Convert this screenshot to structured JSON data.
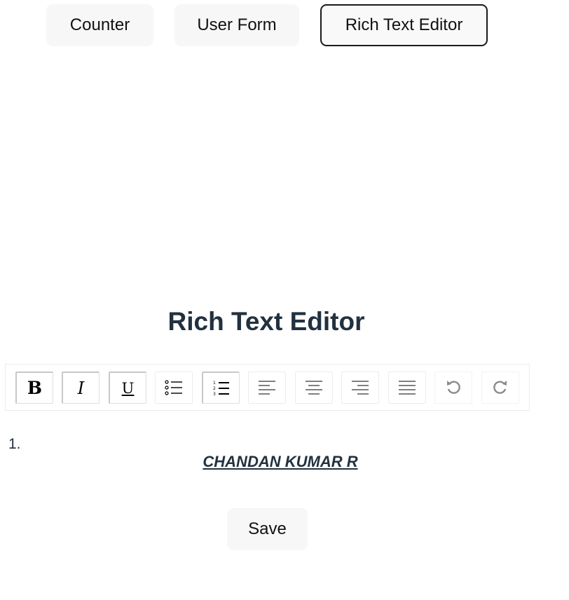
{
  "tabs": [
    {
      "label": "Counter",
      "active": false
    },
    {
      "label": "User Form",
      "active": false
    },
    {
      "label": "Rich Text Editor",
      "active": true
    }
  ],
  "title": "Rich Text Editor",
  "toolbar": {
    "buttons": [
      {
        "name": "bold",
        "icon": "bold-icon",
        "glyph": "B",
        "pressed": true
      },
      {
        "name": "italic",
        "icon": "italic-icon",
        "glyph": "I",
        "pressed": true
      },
      {
        "name": "underline",
        "icon": "underline-icon",
        "glyph": "U",
        "pressed": true
      },
      {
        "name": "bullet-list",
        "icon": "bullet-list-icon",
        "pressed": false
      },
      {
        "name": "numbered-list",
        "icon": "numbered-list-icon",
        "pressed": true
      },
      {
        "name": "align-left",
        "icon": "align-left-icon",
        "pressed": false
      },
      {
        "name": "align-center",
        "icon": "align-center-icon",
        "pressed": false
      },
      {
        "name": "align-right",
        "icon": "align-right-icon",
        "pressed": false
      },
      {
        "name": "align-justify",
        "icon": "align-justify-icon",
        "pressed": false
      },
      {
        "name": "undo",
        "icon": "undo-icon",
        "disabled": true
      },
      {
        "name": "redo",
        "icon": "redo-icon",
        "disabled": true
      }
    ]
  },
  "editor": {
    "list_marker": "1.",
    "content": "CHANDAN KUMAR R"
  },
  "save_label": "Save",
  "colors": {
    "heading": "#22313f",
    "button_bg": "#f7f7f7",
    "active_border": "#1a1a1a"
  }
}
